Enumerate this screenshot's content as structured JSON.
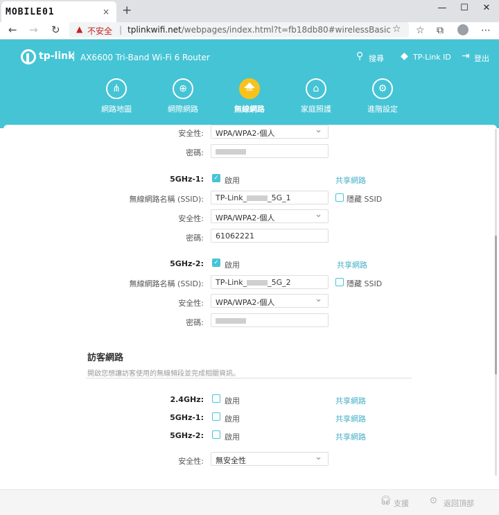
{
  "browser": {
    "tab_title": "MOBILE01",
    "close_glyph": "×",
    "newtab_glyph": "+",
    "window_controls": [
      "—",
      "☐",
      "✕"
    ],
    "back_glyph": "←",
    "forward_glyph": "→",
    "reload_glyph": "↻",
    "insecure_label": "不安全",
    "url_host": "tplinkwifi.net",
    "url_path": "/webpages/index.html?t=fb18db80#wirelessBasic"
  },
  "header": {
    "brand": "tp-link",
    "model": "AX6600 Tri-Band Wi-Fi 6 Router",
    "search_label": "搜尋",
    "tplink_id_label": "TP-Link ID",
    "logout_label": "登出",
    "nav": [
      {
        "label": "網路地圖",
        "icon": "network-map-icon"
      },
      {
        "label": "網際網路",
        "icon": "globe-icon"
      },
      {
        "label": "無線網路",
        "icon": "wifi-icon",
        "active": true
      },
      {
        "label": "家庭照護",
        "icon": "home-care-icon"
      },
      {
        "label": "進階設定",
        "icon": "gear-icon"
      }
    ]
  },
  "wireless": {
    "top": {
      "security_label": "安全性:",
      "security_value": "WPA/WPA2-個人",
      "password_label": "密碼:"
    },
    "band1": {
      "label": "5GHz-1:",
      "enable_label": "啟用",
      "share_label": "共享網路",
      "ssid_label": "無線網路名稱 (SSID):",
      "ssid_prefix": "TP-Link_",
      "ssid_suffix": "_5G_1",
      "hide_ssid_label": "隱藏 SSID",
      "security_label": "安全性:",
      "security_value": "WPA/WPA2-個人",
      "password_label": "密碼:",
      "password_value": "61062221"
    },
    "band2": {
      "label": "5GHz-2:",
      "enable_label": "啟用",
      "share_label": "共享網路",
      "ssid_label": "無線網路名稱 (SSID):",
      "ssid_prefix": "TP-Link_",
      "ssid_suffix": "_5G_2",
      "hide_ssid_label": "隱藏 SSID",
      "security_label": "安全性:",
      "security_value": "WPA/WPA2-個人",
      "password_label": "密碼:"
    }
  },
  "guest": {
    "title": "訪客網路",
    "description": "開啟您想讓訪客使用的無線頻段並完成相關資訊。",
    "bands": [
      {
        "label": "2.4GHz:",
        "enable_label": "啟用",
        "share_label": "共享網路"
      },
      {
        "label": "5GHz-1:",
        "enable_label": "啟用",
        "share_label": "共享網路"
      },
      {
        "label": "5GHz-2:",
        "enable_label": "啟用",
        "share_label": "共享網路"
      }
    ],
    "security_label": "安全性:",
    "security_value": "無安全性"
  },
  "footer": {
    "support_label": "支援",
    "back_to_top_label": "返回頂部"
  },
  "colors": {
    "accent": "#45c4d5",
    "active_nav": "#f8c21c",
    "insecure": "#c5221f"
  }
}
